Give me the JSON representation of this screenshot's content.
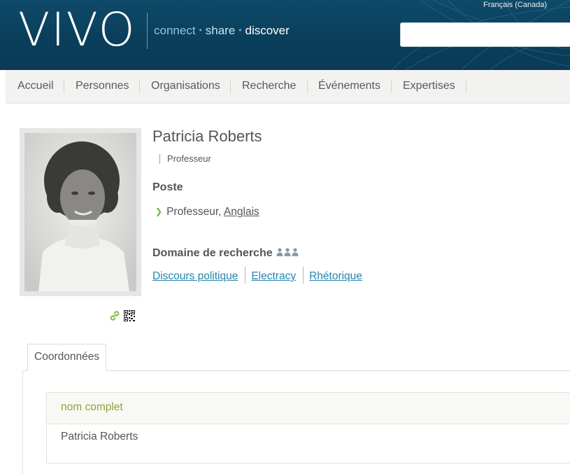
{
  "header": {
    "logo_text": "VIVO",
    "tagline": {
      "part1": "connect",
      "part2": "share",
      "part3": "discover",
      "separator": "•"
    },
    "language": "Français (Canada)",
    "search": {
      "value": "",
      "placeholder": ""
    }
  },
  "nav": {
    "items": [
      {
        "label": "Accueil"
      },
      {
        "label": "Personnes"
      },
      {
        "label": "Organisations"
      },
      {
        "label": "Recherche"
      },
      {
        "label": "Événements"
      },
      {
        "label": "Expertises"
      }
    ]
  },
  "profile": {
    "name": "Patricia Roberts",
    "preferred_title": "Professeur",
    "poste_label": "Poste",
    "position": {
      "title": "Professeur, ",
      "org": "Anglais"
    },
    "research_label": "Domaine de recherche",
    "research_areas": [
      "Discours politique",
      "Electracy",
      "Rhétorique"
    ]
  },
  "tabs": [
    {
      "label": "Coordonnées"
    }
  ],
  "contact": {
    "label": "nom complet",
    "value": "Patricia Roberts"
  },
  "colors": {
    "header_bg": "#0b3f5c",
    "link": "#2485ae",
    "accent_green": "#6db33f",
    "property_label": "#8da638",
    "text": "#555555"
  },
  "icons": {
    "link": "link-icon",
    "qr": "qr-code-icon",
    "people": "people-group-icon",
    "arrow": "chevron-right-icon"
  }
}
